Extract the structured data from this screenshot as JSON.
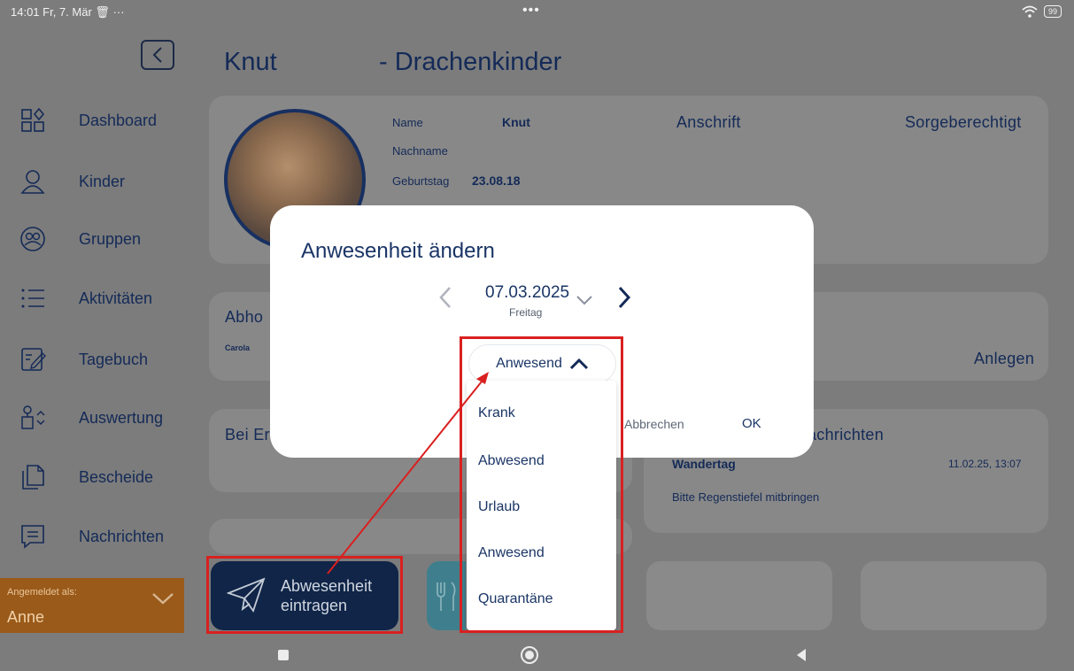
{
  "status_bar": {
    "time": "14:01",
    "date": "Fr, 7. Mär",
    "extra": "···",
    "center_dots": "•••",
    "battery": "99"
  },
  "sidebar": {
    "items": [
      {
        "label": "Dashboard",
        "icon": "dashboard-icon"
      },
      {
        "label": "Kinder",
        "icon": "person-icon"
      },
      {
        "label": "Gruppen",
        "icon": "group-icon"
      },
      {
        "label": "Aktivitäten",
        "icon": "list-icon"
      },
      {
        "label": "Tagebuch",
        "icon": "diary-icon"
      },
      {
        "label": "Auswertung",
        "icon": "evaluation-icon"
      },
      {
        "label": "Bescheide",
        "icon": "documents-icon"
      },
      {
        "label": "Nachrichten",
        "icon": "messages-icon"
      }
    ],
    "account": {
      "prefix": "Angemeldet als:",
      "name": "Anne"
    }
  },
  "header": {
    "name": "Knut",
    "group": "- Drachenkinder"
  },
  "profile": {
    "name_label": "Name",
    "name_value": "Knut",
    "lastname_label": "Nachname",
    "birthday_label": "Geburtstag",
    "birthday_value": "23.08.18",
    "address_heading": "Anschrift",
    "guardian_heading": "Sorgeberechtigt"
  },
  "pickup": {
    "heading": "Abho",
    "person": "Carola",
    "create_link": "Anlegen"
  },
  "emergency": {
    "heading": "Bei Er"
  },
  "messages": {
    "heading": "achrichten",
    "item_title": "Wandertag",
    "item_time": "11.02.25, 13:07",
    "item_text": "Bitte Regenstiefel mitbringen"
  },
  "actions": {
    "absence_line1": "Abwesenheit",
    "absence_line2": "eintragen"
  },
  "dialog": {
    "title": "Anwesenheit ändern",
    "date": "07.03.2025",
    "weekday": "Freitag",
    "selected_status": "Anwesend",
    "cancel_label": "Abbrechen",
    "ok_label": "OK"
  },
  "dropdown": {
    "options": [
      "Krank",
      "Abwesend",
      "Urlaub",
      "Anwesend",
      "Quarantäne"
    ]
  },
  "colors": {
    "primary": "#142a57",
    "annotation": "#d92020",
    "account_bg": "#9a5a1a"
  }
}
